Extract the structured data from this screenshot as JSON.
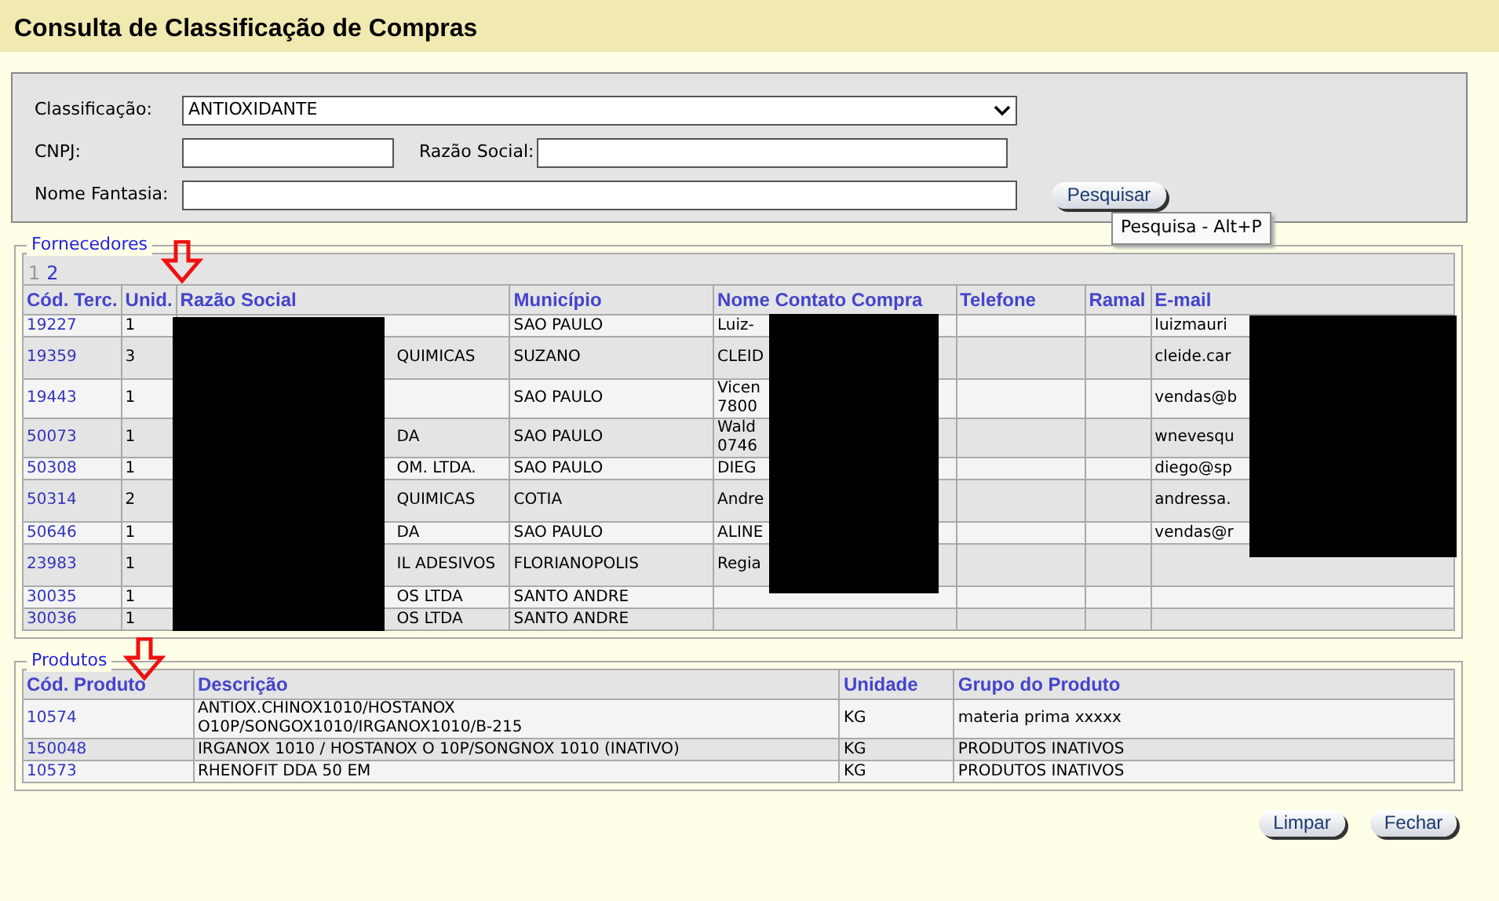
{
  "title": "Consulta de Classificação de Compras",
  "filter": {
    "classificacao_label": "Classificação:",
    "classificacao_value": "ANTIOXIDANTE",
    "cnpj_label": "CNPJ:",
    "razao_label": "Razão Social:",
    "fantasia_label": "Nome Fantasia:",
    "search_button": "Pesquisar",
    "tooltip": "Pesquisa - Alt+P"
  },
  "fornecedores": {
    "legend": "Fornecedores",
    "pages": [
      {
        "label": "1",
        "selected": true
      },
      {
        "label": "2",
        "selected": false
      }
    ],
    "columns": [
      "Cód. Terc.",
      "Unid.",
      "Razão Social",
      "Município",
      "Nome Contato Compra",
      "Telefone",
      "Ramal",
      "E-mail"
    ],
    "rows": [
      {
        "cod": "19227",
        "unid": "1",
        "razao": "",
        "municipio": "SAO PAULO",
        "contato": "Luiz-",
        "email": "luizmauri"
      },
      {
        "cod": "19359",
        "unid": "3",
        "razao": "QUIMICAS",
        "municipio": "SUZANO",
        "contato": "CLEID",
        "email": "cleide.car",
        "tall": true
      },
      {
        "cod": "19443",
        "unid": "1",
        "razao": "",
        "municipio": "SAO PAULO",
        "contato": "Vicen\n7800",
        "email": "vendas@b"
      },
      {
        "cod": "50073",
        "unid": "1",
        "razao": "DA",
        "municipio": "SAO PAULO",
        "contato": "Wald\n0746",
        "email": "wnevesqu"
      },
      {
        "cod": "50308",
        "unid": "1",
        "razao": "OM. LTDA.",
        "municipio": "SAO PAULO",
        "contato": "DIEG",
        "email": "diego@sp"
      },
      {
        "cod": "50314",
        "unid": "2",
        "razao": "QUIMICAS",
        "municipio": "COTIA",
        "contato": "Andre",
        "email": "andressa.",
        "tall": true
      },
      {
        "cod": "50646",
        "unid": "1",
        "razao": "DA",
        "municipio": "SAO PAULO",
        "contato": "ALINE",
        "email": "vendas@r"
      },
      {
        "cod": "23983",
        "unid": "1",
        "razao": "IL ADESIVOS",
        "municipio": "FLORIANOPOLIS",
        "contato": "Regia",
        "email": "",
        "tall": true
      },
      {
        "cod": "30035",
        "unid": "1",
        "razao": "OS LTDA",
        "municipio": "SANTO ANDRE",
        "contato": "",
        "email": ""
      },
      {
        "cod": "30036",
        "unid": "1",
        "razao": "OS LTDA",
        "municipio": "SANTO ANDRE",
        "contato": "",
        "email": ""
      }
    ]
  },
  "produtos": {
    "legend": "Produtos",
    "columns": [
      "Cód. Produto",
      "Descrição",
      "Unidade",
      "Grupo do Produto"
    ],
    "rows": [
      {
        "cod": "10574",
        "descricao": "ANTIOX.CHINOX1010/HOSTANOX\nO10P/SONGOX1010/IRGANOX1010/B-215",
        "unidade": "KG",
        "grupo": "materia prima xxxxx"
      },
      {
        "cod": "150048",
        "descricao": "IRGANOX 1010 / HOSTANOX O 10P/SONGNOX 1010 (INATIVO)",
        "unidade": "KG",
        "grupo": "PRODUTOS INATIVOS"
      },
      {
        "cod": "10573",
        "descricao": "RHENOFIT DDA 50 EM",
        "unidade": "KG",
        "grupo": "PRODUTOS INATIVOS"
      }
    ]
  },
  "buttons": [
    "Limpar",
    "Fechar"
  ]
}
